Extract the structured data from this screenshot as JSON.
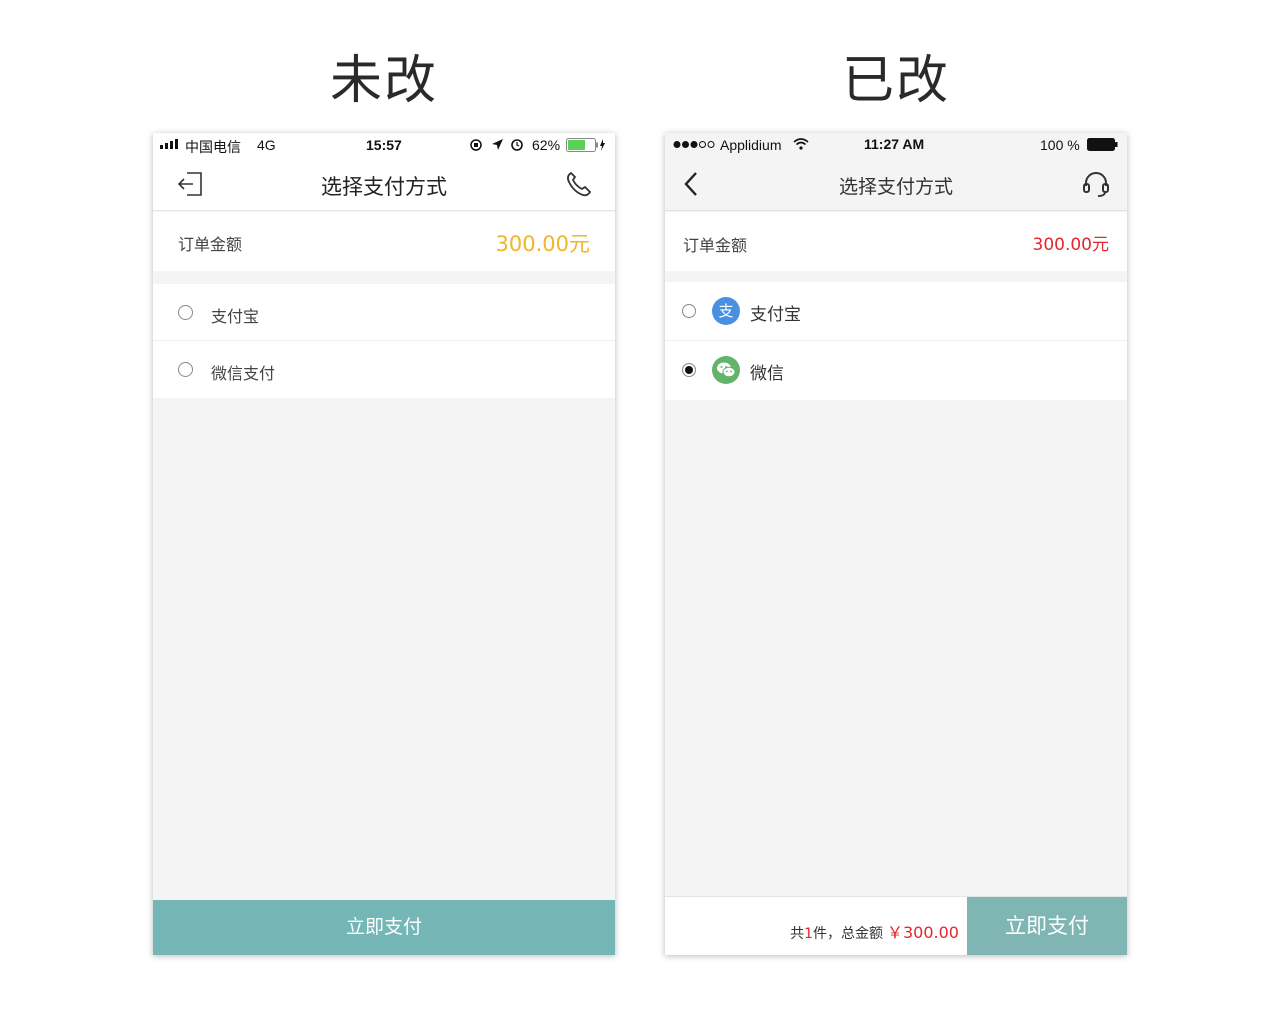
{
  "labels": {
    "before": "未改",
    "after": "已改"
  },
  "before": {
    "status": {
      "carrier": "中国电信",
      "network": "4G",
      "time": "15:57",
      "battery": "62%"
    },
    "nav": {
      "title": "选择支付方式",
      "back_icon": "exit-icon",
      "call_icon": "phone-icon"
    },
    "order": {
      "label": "订单金额",
      "amount": "300.00元",
      "amount_color": "#f0b52a"
    },
    "methods": [
      {
        "label": "支付宝",
        "checked": false
      },
      {
        "label": "微信支付",
        "checked": false
      }
    ],
    "pay_button": "立即支付",
    "accent": "#75b7b6"
  },
  "after": {
    "status": {
      "carrier": "Applidium",
      "time": "11:27 AM",
      "battery": "100 %"
    },
    "nav": {
      "title": "选择支付方式",
      "back_icon": "chevron-left-icon",
      "service_icon": "headset-icon"
    },
    "order": {
      "label": "订单金额",
      "amount": "300.00元",
      "amount_color": "#e3262c"
    },
    "methods": [
      {
        "label": "支付宝",
        "icon": "alipay-icon",
        "icon_glyph": "支",
        "icon_color": "#4a90e2",
        "checked": false
      },
      {
        "label": "微信",
        "icon": "wechat-icon",
        "icon_color": "#62b46a",
        "checked": true
      }
    ],
    "summary": {
      "prefix": "共",
      "count": "1",
      "middle": "件，总金额",
      "total": "￥300.00"
    },
    "pay_button": "立即支付",
    "accent": "#7fb6b4"
  }
}
